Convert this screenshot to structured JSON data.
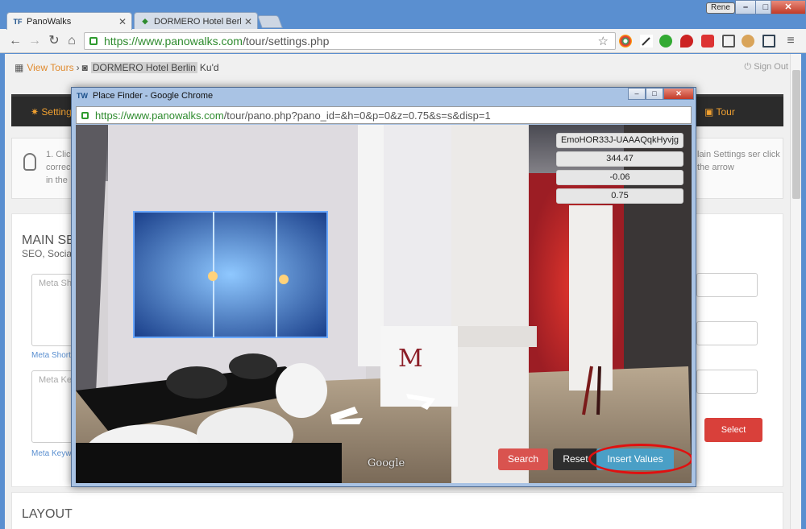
{
  "browser": {
    "tabs": [
      {
        "label": "PanoWalks",
        "icon": "TF"
      },
      {
        "label": "DORMERO Hotel Berlin Ku",
        "icon": "map-pin-icon"
      }
    ],
    "user": "Rene",
    "url_secure": "https://www.panowalks.com",
    "url_path": "/tour/settings.php"
  },
  "page": {
    "breadcrumb": {
      "view_tours": "View Tours",
      "current": "DORMERO Hotel Berlin",
      "tail": "Ku'd"
    },
    "sign_out": "Sign Out",
    "nav": {
      "settings": "Settings",
      "tour": "Tour"
    },
    "info_left": "1. Click correc in the",
    "info_right": "lain Settings ser click the arrow",
    "main_title": "MAIN SE",
    "main_subtitle": "SEO, Social",
    "meta_short_placeholder": "Meta Sh",
    "meta_short_label": "Meta Short",
    "meta_key_placeholder": "Meta Ke",
    "meta_key_label": "Meta Keyw",
    "select_button": "Select",
    "layout_title": "LAYOUT"
  },
  "popup": {
    "window_title": "Place Finder - Google Chrome",
    "url_secure": "https://www.panowalks.com",
    "url_path": "/tour/pano.php?pano_id=&h=0&p=0&z=0.75&s=s&disp=1",
    "values": {
      "pano_id": "EmoHOR33J-UAAAQqkHyvjg",
      "heading": "344.47",
      "pitch": "-0.06",
      "zoom": "0.75"
    },
    "buttons": {
      "search": "Search",
      "reset": "Reset",
      "insert": "Insert Values"
    },
    "watermark": "Google"
  },
  "colors": {
    "accent_orange": "#f0a030",
    "danger": "#d9534f",
    "info": "#4a9fc6",
    "highlight_ring": "#e01010"
  }
}
